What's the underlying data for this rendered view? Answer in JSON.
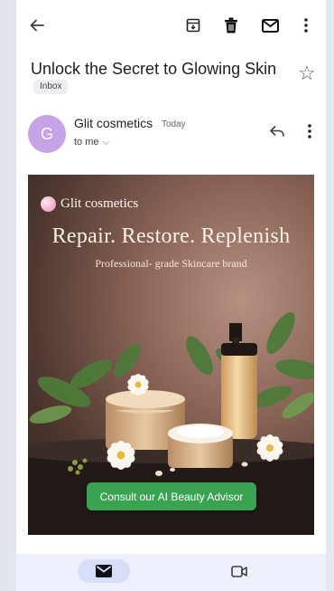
{
  "email": {
    "subject": "Unlock the Secret to Glowing Skin",
    "label": "Inbox",
    "sender_initial": "G",
    "sender_name": "Glit cosmetics",
    "time": "Today",
    "recipient": "to me"
  },
  "banner": {
    "brand": "Glit cosmetics",
    "headline": "Repair. Restore. Replenish",
    "tagline": "Professional- grade Skincare brand",
    "cta": "Consult our AI Beauty Advisor"
  },
  "colors": {
    "avatar": "#c6a3e6",
    "cta": "#3aa352",
    "nav_active": "#d9def8"
  },
  "icons": {
    "back": "arrow-left",
    "archive": "archive-box",
    "delete": "trash",
    "unread": "envelope",
    "more": "dots-vertical",
    "star": "star-outline",
    "reply": "reply-arrow",
    "mail_nav": "envelope-filled",
    "meet_nav": "video-camera"
  }
}
